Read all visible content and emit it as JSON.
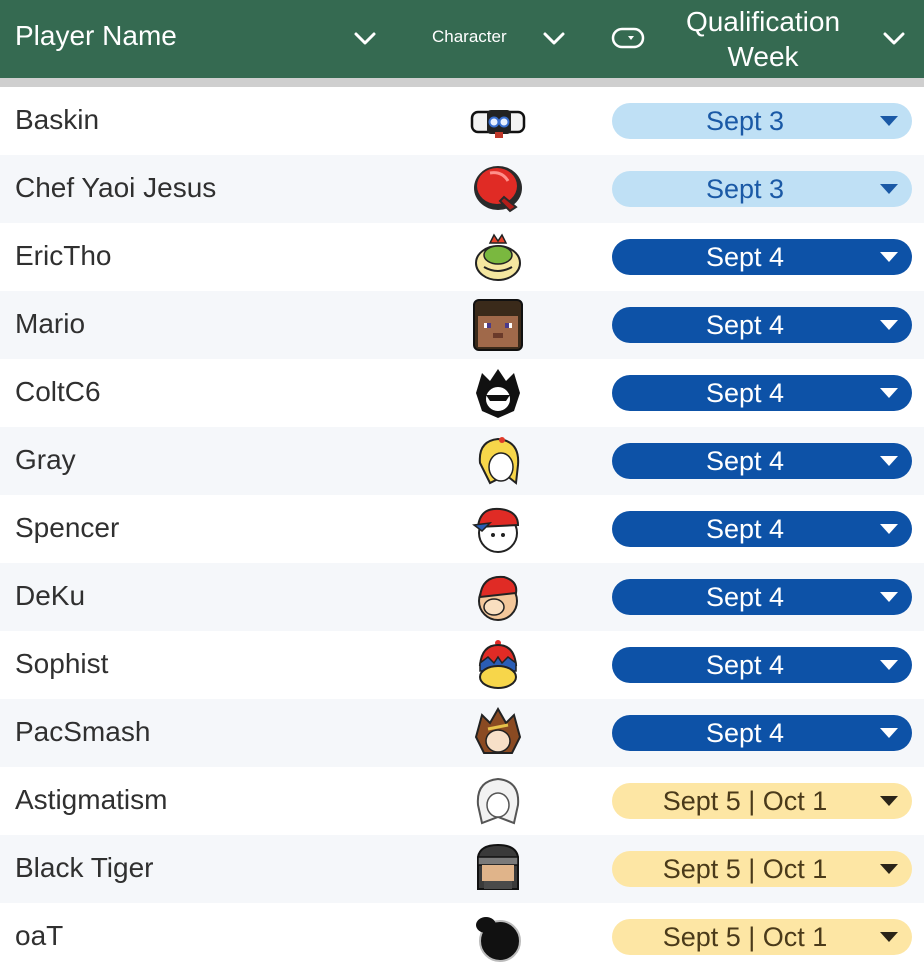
{
  "header": {
    "player_name": "Player Name",
    "character": "Character",
    "qualification_week_line1": "Qualification",
    "qualification_week_line2": "Week"
  },
  "colors": {
    "header_bg": "#356a51",
    "pill_sept3": "#bfe0f5",
    "pill_sept4": "#0d52a7",
    "pill_sept5": "#fde6a4"
  },
  "rows": [
    {
      "player": "Baskin",
      "character_icon": "rob-robot-icon",
      "week": "Sept 3"
    },
    {
      "player": "Chef Yaoi Jesus",
      "character_icon": "boxing-glove-icon",
      "week": "Sept 3"
    },
    {
      "player": "EricTho",
      "character_icon": "bowser-jr-icon",
      "week": "Sept 4"
    },
    {
      "player": "Mario",
      "character_icon": "minecraft-steve-icon",
      "week": "Sept 4"
    },
    {
      "player": "ColtC6",
      "character_icon": "joker-icon",
      "week": "Sept 4"
    },
    {
      "player": "Gray",
      "character_icon": "zero-suit-samus-icon",
      "week": "Sept 4"
    },
    {
      "player": "Spencer",
      "character_icon": "ness-icon",
      "week": "Sept 4"
    },
    {
      "player": "DeKu",
      "character_icon": "diddy-kong-icon",
      "week": "Sept 4"
    },
    {
      "player": "Sophist",
      "character_icon": "king-dedede-icon",
      "week": "Sept 4"
    },
    {
      "player": "PacSmash",
      "character_icon": "pit-icon",
      "week": "Sept 4"
    },
    {
      "player": "Astigmatism",
      "character_icon": "corrin-icon",
      "week": "Sept 5 | Oct 1"
    },
    {
      "player": "Black Tiger",
      "character_icon": "snake-icon",
      "week": "Sept 5 | Oct 1"
    },
    {
      "player": "oaT",
      "character_icon": "game-and-watch-icon",
      "week": "Sept 5 | Oct 1"
    }
  ]
}
